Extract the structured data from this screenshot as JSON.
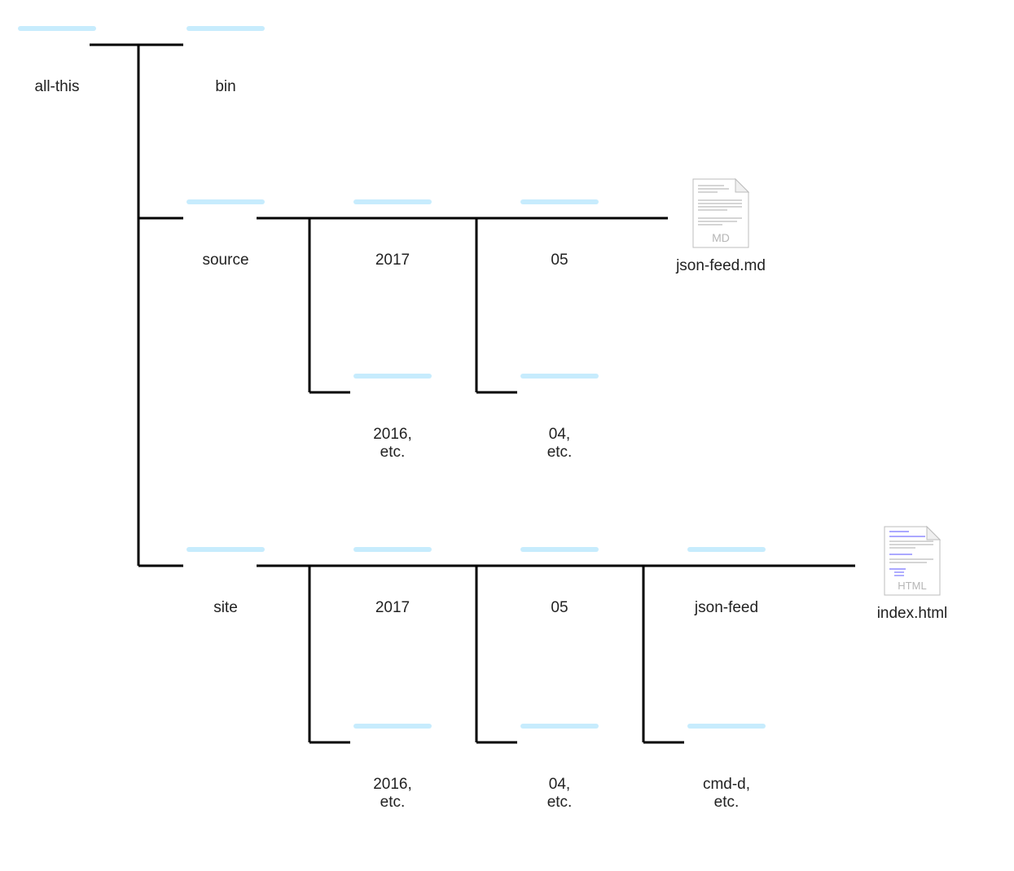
{
  "nodes": {
    "allthis": {
      "label": "all-this"
    },
    "bin": {
      "label": "bin"
    },
    "source": {
      "label": "source"
    },
    "s2017": {
      "label": "2017"
    },
    "s05": {
      "label": "05"
    },
    "s2016": {
      "label": "2016,\netc."
    },
    "s04": {
      "label": "04,\netc."
    },
    "jsonmd": {
      "label": "json-feed.md",
      "ext": "MD"
    },
    "site": {
      "label": "site"
    },
    "t2017": {
      "label": "2017"
    },
    "t05": {
      "label": "05"
    },
    "jsonfeed": {
      "label": "json-feed"
    },
    "indexhtml": {
      "label": "index.html",
      "ext": "HTML"
    },
    "t2016": {
      "label": "2016,\netc."
    },
    "t04": {
      "label": "04,\netc."
    },
    "cmdd": {
      "label": "cmd-d,\netc."
    }
  }
}
